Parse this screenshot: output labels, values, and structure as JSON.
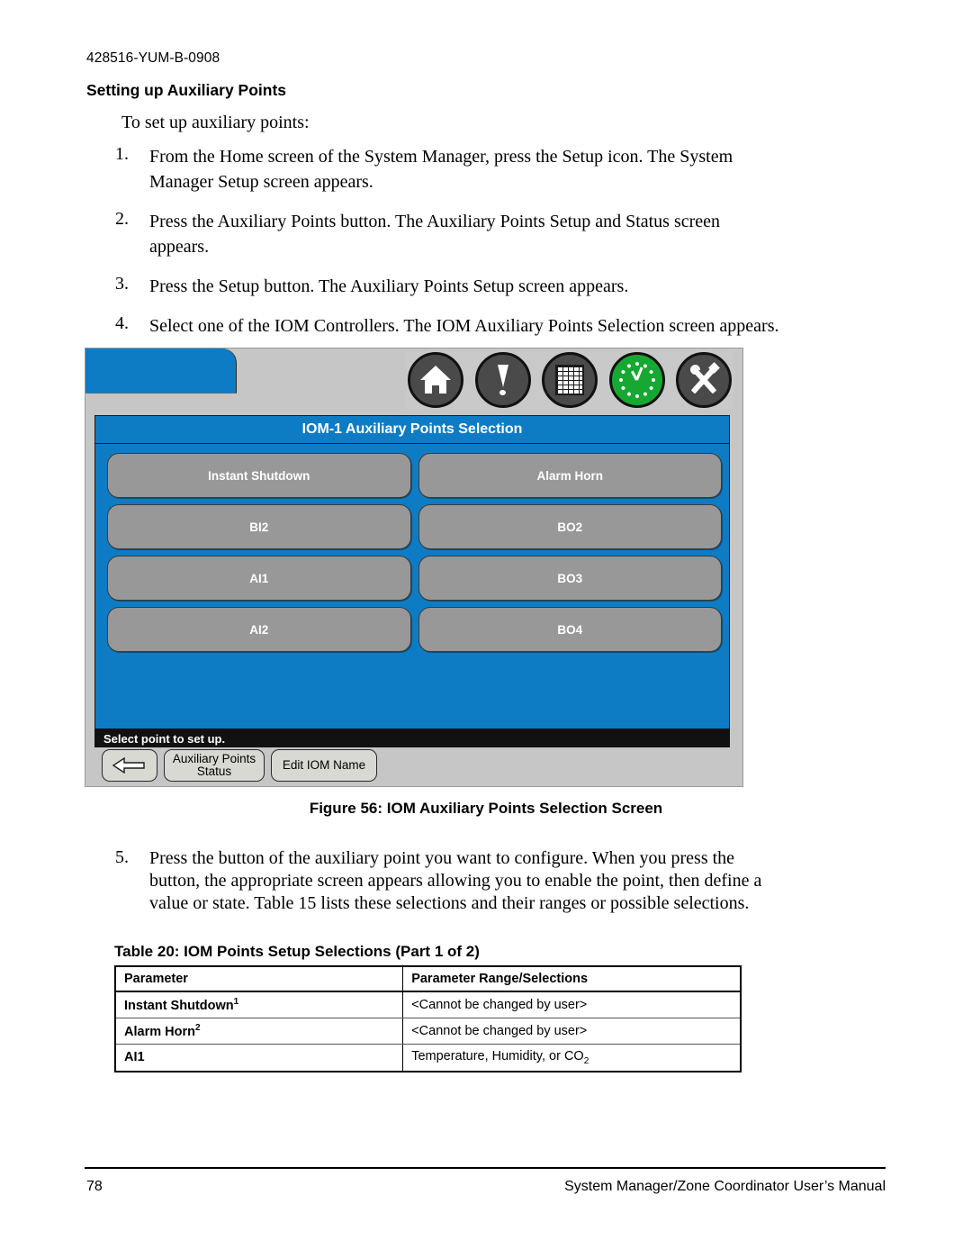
{
  "document": {
    "doc_id": "428516-YUM-B-0908",
    "section_title": "Setting up Auxiliary Points",
    "lead_in": "To set up auxiliary points:"
  },
  "steps": [
    {
      "num": "1.",
      "text": "From the Home screen of the System Manager, press the Setup icon. The System Manager Setup screen appears."
    },
    {
      "num": "2.",
      "text": "Press the Auxiliary Points button. The Auxiliary Points Setup and Status screen appears."
    },
    {
      "num": "3.",
      "text": "Press the Setup button. The Auxiliary Points Setup screen appears."
    },
    {
      "num": "4.",
      "text": "Select one of the IOM Controllers. The IOM Auxiliary Points Selection screen appears."
    }
  ],
  "step5": {
    "num": "5.",
    "text": "Press the button of the auxiliary point you want to configure. When you press the button, the appropriate screen appears allowing you to enable the point, then define a value or state. Table 15 lists these selections and their ranges or possible selections."
  },
  "figure": {
    "caption": "Figure 56: IOM Auxiliary Points Selection Screen",
    "screen": {
      "title": "IOM-1 Auxiliary Points Selection",
      "status_text": "Select point to set up.",
      "toolbar_icons": [
        "home-icon",
        "alert-icon",
        "schedule-grid-icon",
        "clock-icon",
        "tools-icon"
      ],
      "buttons": [
        "Instant Shutdown",
        "Alarm Horn",
        "BI2",
        "BO2",
        "AI1",
        "BO3",
        "AI2",
        "BO4"
      ],
      "footer_buttons": {
        "back": "back-arrow-icon",
        "aux_status": "Auxiliary Points Status",
        "edit_name": "Edit IOM Name"
      }
    },
    "colors": {
      "blue": "#0d7cc4",
      "button_gray": "#989898",
      "frame_gray": "#c6c6c6",
      "status_black": "#111111",
      "clock_green": "#16a832"
    }
  },
  "table": {
    "title": "Table 20: IOM Points Setup Selections (Part 1 of 2)",
    "headers": [
      "Parameter",
      "Parameter Range/Selections"
    ],
    "rows": [
      {
        "param": "Instant Shutdown",
        "param_sup": "1",
        "value": "<Cannot be changed by user>"
      },
      {
        "param": "Alarm Horn",
        "param_sup": "2",
        "value": "<Cannot be changed by user>"
      },
      {
        "param": "AI1",
        "param_sup": "",
        "value_pre": "Temperature, Humidity, or CO",
        "value_sub": "2"
      }
    ]
  },
  "footer": {
    "page_number": "78",
    "manual_title": "System Manager/Zone Coordinator User’s Manual"
  }
}
